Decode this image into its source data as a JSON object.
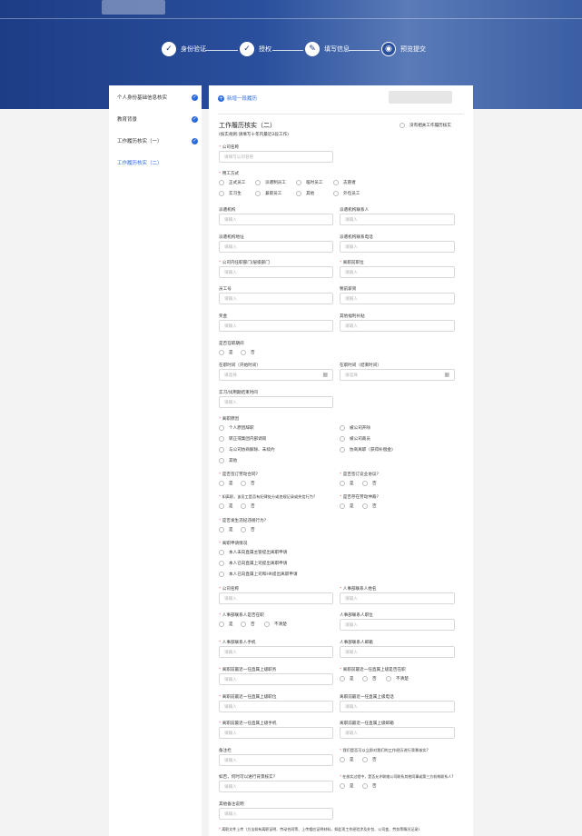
{
  "steps": [
    {
      "label": "身份验证",
      "icon": "user-icon"
    },
    {
      "label": "授权",
      "icon": "shield-icon"
    },
    {
      "label": "填写信息",
      "icon": "edit-icon"
    },
    {
      "label": "预览提交",
      "icon": "eye-icon"
    }
  ],
  "sidebar": {
    "items": [
      {
        "label": "个人身份基础信息核实"
      },
      {
        "label": "教育背景"
      },
      {
        "label": "工作履历核实（一）"
      },
      {
        "label": "工作履历核实（二）"
      }
    ]
  },
  "form": {
    "add_label": "新增一段履历",
    "title": "工作履历核实（二）",
    "subtitle": "(核实规则:请填写十年内最近2段工作)",
    "no_work": "没有相关工作履历核实",
    "ph_input": "请输入",
    "ph_select": "请选择",
    "company_name": {
      "label": "公司名称",
      "placeholder": "请填写公司名称"
    },
    "employment_type": {
      "label": "用工方式",
      "options": [
        "正式员工",
        "派遣制员工",
        "临时员工",
        "志愿者",
        "实习生",
        "兼职员工",
        "其他",
        "外包员工"
      ]
    },
    "labels": {
      "dispatch_org": "派遣机构",
      "dispatch_contact": "派遣机构联系人",
      "dispatch_addr": "派遣机构地址",
      "dispatch_phone": "派遣机构联系电话",
      "dept": "公司内任职部门/层级部门",
      "position": "离职前职位",
      "emp_no": "员工号",
      "monthly_salary": "税前薪资",
      "bonus": "奖金",
      "other_benefits": "其他福利补贴",
      "in_service": "是否在职期间",
      "start_time": "在职时间（开始时间）",
      "end_time": "在职时间（结束时间）",
      "probation_end": "实习/试用期结束时间",
      "leave_reason": "离职原因",
      "contract_sign": "是否签订劳动合同?",
      "noncompete": "是否签订竞业协议?",
      "record_question": "如离职，该员工是否有纪律处分或违规记录或失信行为?",
      "rehire_question": "是否存在劳动仲裁?",
      "criminal": "是否发生违纪违规行为?",
      "leave_process": "离职申请情况",
      "hr_company": "公司名称",
      "hr_name": "人事部联系人姓名",
      "hr_gender": "人事部联系人是否在职",
      "hr_position": "人事部联系人职位",
      "hr_mobile": "人事部联系人手机",
      "hr_email": "人事部联系人邮箱",
      "sup_position": "离职前最近一任直属上级职务",
      "sup_inservice": "离职前最近一任直属上级是否在职",
      "sup_name": "离职前最近一任直属上级职位",
      "sup_phone": "离职前最近一任直属上级电话",
      "sup_mobile": "离职前最近一任直属上级手机",
      "sup_email": "离职前最近一任直属上级邮箱",
      "remark": "备注栏",
      "consent_question": "我们是否可以立即对我们的工作经历进行背景核实?",
      "other_q": "如否，何时可以进行背景核实?",
      "contact_q": "在核实过程中，是否允许联络公司联系其他同事或第三方机构联系人?",
      "other_note": "其他备注说明",
      "upload": "离职文件上传（方法如有离职证明、劳动合同等、上传相应证明材料，如此项工作经验涉及外包、公司变、劳务等情况记录)"
    },
    "yes": "是",
    "no": "否",
    "unclear": "不清楚",
    "leave_reasons": [
      "个人原因辞职",
      "被公司开除",
      "转正或集团内部调岗",
      "被公司裁员",
      "与公司协商解除、未续约",
      "协商离职（获得补偿金)",
      "其他"
    ],
    "leave_process_opts": [
      "本人未向直属主管提出离职申请",
      "本人已向直属上司提出离职申请",
      "本人已向直属上司和HR提出离职申请"
    ]
  }
}
